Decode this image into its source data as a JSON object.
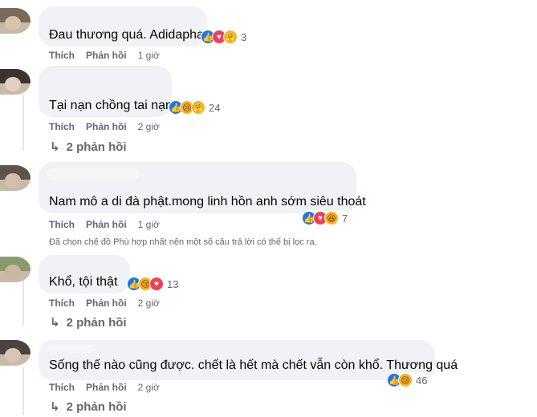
{
  "comments": [
    {
      "text": "Đau thương quá. Adidaphat",
      "reaction_icons": [
        "like-icon",
        "love-icon",
        "care-icon"
      ],
      "reaction_count": "3",
      "like_label": "Thích",
      "reply_label": "Phản hồi",
      "time": "1 giờ"
    },
    {
      "text": "Tại nạn chồng tai nạn",
      "reaction_icons": [
        "like-icon",
        "sad-icon",
        "care-icon"
      ],
      "reaction_count": "24",
      "like_label": "Thích",
      "reply_label": "Phản hồi",
      "time": "2 giờ",
      "replies_label": "2 phản hồi"
    },
    {
      "text": "Nam mô a di đà phật.mong linh hồn anh sớm siêu thoát",
      "reaction_icons": [
        "like-icon",
        "love-icon",
        "haha-icon"
      ],
      "reaction_count": "7",
      "like_label": "Thích",
      "reply_label": "Phản hồi",
      "time": "1 giờ",
      "notice": "Đã chọn chế độ Phù hợp nhất nên một số câu trả lời có thể bị lọc ra."
    },
    {
      "text": "Khổ, tội thật",
      "reaction_icons": [
        "like-icon",
        "sad-icon",
        "love-icon"
      ],
      "reaction_count": "13",
      "like_label": "Thích",
      "reply_label": "Phản hồi",
      "time": "2 giờ",
      "replies_label": "2 phản hồi"
    },
    {
      "text": "Sống thế nào cũng được. chết là hết mà chết vẫn còn khổ. Thương quá",
      "reaction_icons": [
        "like-icon",
        "sad-icon"
      ],
      "reaction_count": "46",
      "like_label": "Thích",
      "reply_label": "Phản hồi",
      "time": "2 giờ",
      "replies_label": "2 phản hồi"
    }
  ],
  "colors": {
    "bubble": "#f0f2f5",
    "secondary_text": "#65676b",
    "like": "#1877f2",
    "love": "#f33e58",
    "emoji": "#f7b125"
  }
}
